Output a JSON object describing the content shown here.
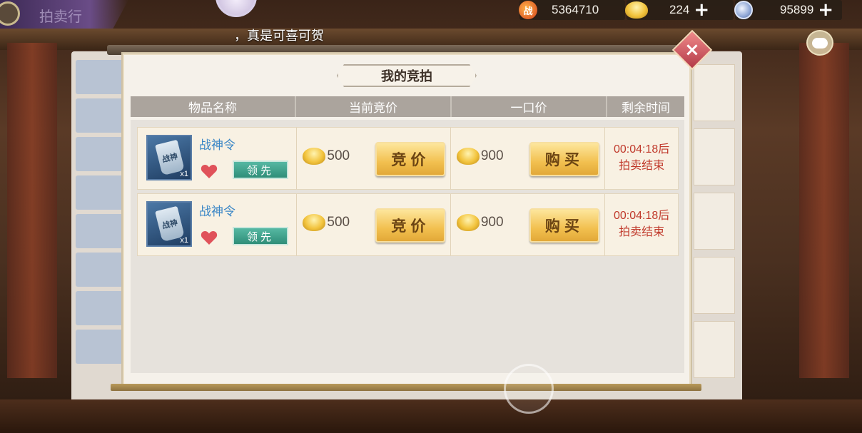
{
  "hud": {
    "window_title": "拍卖行",
    "power_value": "5364710",
    "power_icon_text": "战",
    "gold_ingot_value": "224",
    "silver_coin_value": "95899",
    "plus_symbol": "+"
  },
  "marquee_text": "，真是可喜可贺",
  "modal": {
    "title": "我的竞拍",
    "close_symbol": "×",
    "columns": [
      "物品名称",
      "当前竞价",
      "一口价",
      "剩余时间"
    ]
  },
  "rows": [
    {
      "item_name": "战神令",
      "item_icon_text": "战神",
      "quantity": "x1",
      "status_badge": "领先",
      "current_bid": "500",
      "bid_button": "竞价",
      "buyout_price": "900",
      "buy_button": "购买",
      "time_left": "00:04:18后",
      "time_note": "拍卖结束"
    },
    {
      "item_name": "战神令",
      "item_icon_text": "战神",
      "quantity": "x1",
      "status_badge": "领先",
      "current_bid": "500",
      "bid_button": "竞价",
      "buyout_price": "900",
      "buy_button": "购买",
      "time_left": "00:04:18后",
      "time_note": "拍卖结束"
    }
  ],
  "icons": {
    "power": "war-emblem-icon",
    "gold": "gold-ingot-icon",
    "silver": "silver-coin-icon",
    "favorite": "heart-icon",
    "chat": "chat-bubble-icon"
  },
  "colors": {
    "time_text": "#c0392b",
    "item_name": "#3a86c6",
    "badge_green": "#2f8e78",
    "button_gold": "#f2c04f"
  }
}
